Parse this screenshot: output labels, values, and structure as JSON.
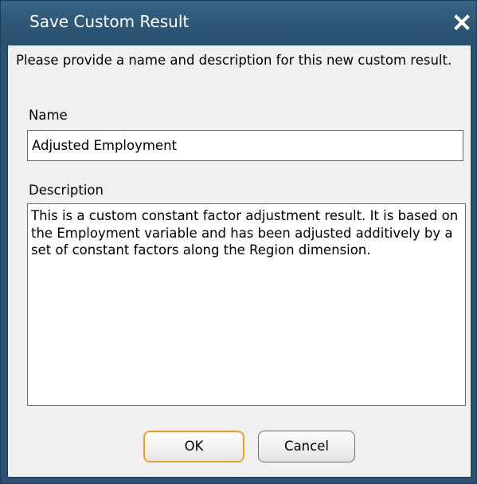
{
  "dialog": {
    "title": "Save Custom Result",
    "close_icon": "close-icon",
    "prompt": "Please provide a name and description for this new custom result."
  },
  "form": {
    "name_label": "Name",
    "name_value": "Adjusted Employment",
    "description_label": "Description",
    "description_value": "This is a custom constant factor adjustment result. It is based on the Employment variable and has been adjusted additively by a set of constant factors along the Region dimension."
  },
  "buttons": {
    "ok_label": "OK",
    "cancel_label": "Cancel"
  },
  "colors": {
    "titlebar": "#2f5879",
    "default_button_border": "#e3a23c",
    "client_background": "#f0f0f0"
  }
}
